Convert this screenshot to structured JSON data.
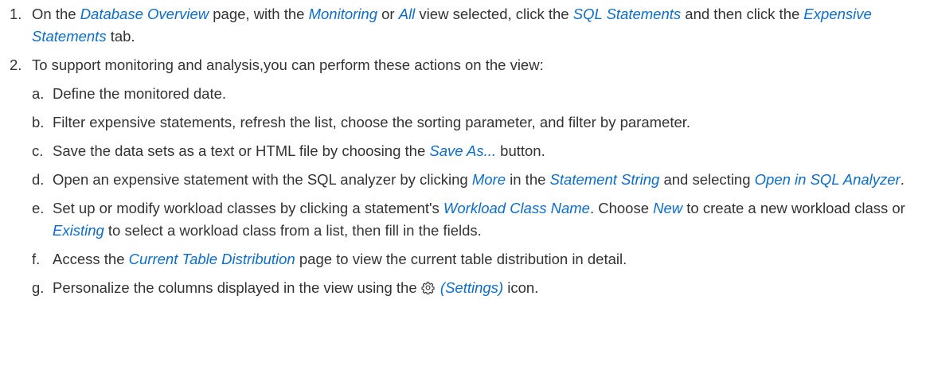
{
  "steps": [
    {
      "number": "1.",
      "parts": [
        "On the ",
        "Database Overview",
        " page, with the ",
        "Monitoring",
        " or ",
        "All",
        " view selected, click the ",
        "SQL Statements",
        " and then click the ",
        "Expensive Statements",
        " tab."
      ]
    },
    {
      "number": "2.",
      "text": "To support monitoring and analysis,you can perform these actions on the view:",
      "substeps": [
        {
          "letter": "a.",
          "text": "Define the monitored date."
        },
        {
          "letter": "b.",
          "text": "Filter expensive statements, refresh the list, choose the sorting parameter, and filter by parameter."
        },
        {
          "letter": "c.",
          "parts": [
            "Save the data sets as a text or HTML file by choosing the ",
            "Save As...",
            " button."
          ]
        },
        {
          "letter": "d.",
          "parts": [
            "Open an expensive statement with the SQL analyzer by clicking ",
            "More",
            " in the ",
            "Statement String",
            " and selecting ",
            "Open in SQL Analyzer",
            "."
          ]
        },
        {
          "letter": "e.",
          "parts": [
            "Set up or modify workload classes by clicking a statement's ",
            "Workload Class Name",
            ". Choose ",
            "New",
            " to create a new workload class or ",
            "Existing",
            " to select a workload class from a list, then fill in the fields."
          ]
        },
        {
          "letter": "f.",
          "parts": [
            "Access the ",
            "Current Table Distribution",
            " page to view the current table distribution in detail."
          ]
        },
        {
          "letter": "g.",
          "parts": [
            "Personalize the columns displayed in the view using the ",
            " ",
            "(Settings)",
            " icon."
          ],
          "icon": "gear-icon"
        }
      ]
    }
  ],
  "colors": {
    "link": "#0a6ed1",
    "text": "#333333"
  }
}
